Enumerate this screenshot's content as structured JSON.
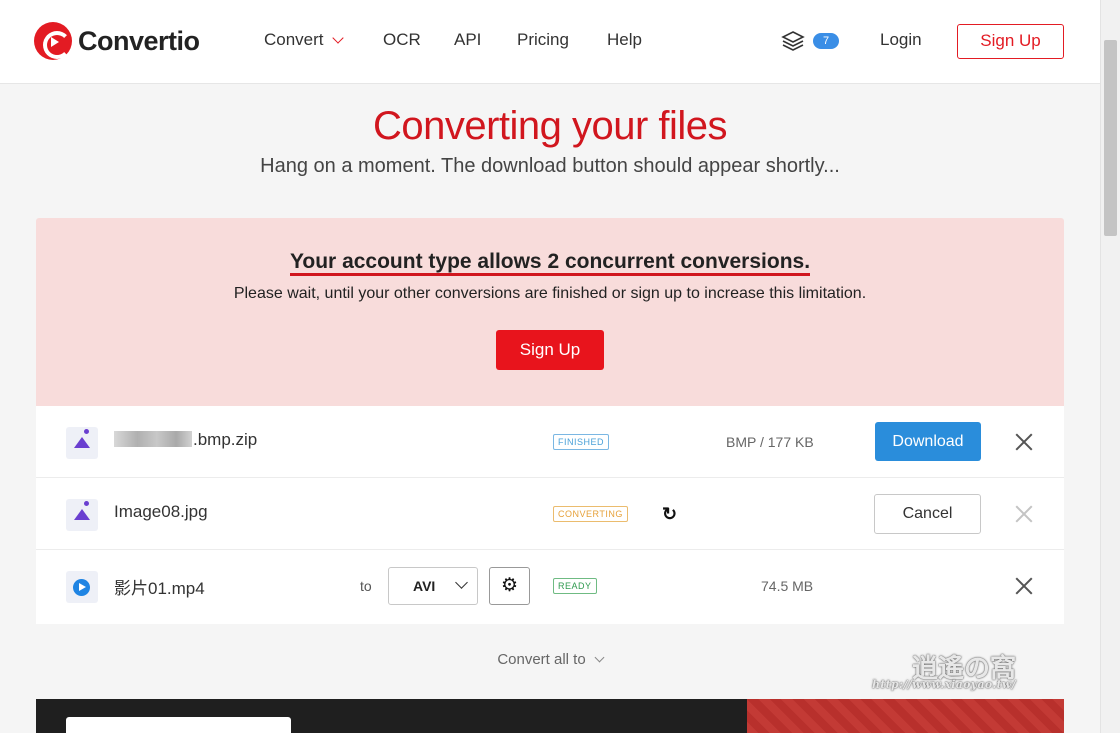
{
  "header": {
    "brand": "Convertio",
    "nav": {
      "convert": "Convert",
      "ocr": "OCR",
      "api": "API",
      "pricing": "Pricing",
      "help": "Help"
    },
    "files_badge": "7",
    "login": "Login",
    "signup": "Sign Up"
  },
  "page": {
    "title": "Converting your files",
    "subtitle": "Hang on a moment. The download button should appear shortly..."
  },
  "alert": {
    "headline": "Your account type allows 2 concurrent conversions.",
    "message": "Please wait, until your other conversions are finished or sign up to increase this limitation.",
    "button": "Sign Up"
  },
  "files": [
    {
      "name": ".bmp.zip",
      "status": "FINISHED",
      "meta": "BMP / 177 KB",
      "action": "Download",
      "icon": "image-icon"
    },
    {
      "name": "Image08.jpg",
      "status": "CONVERTING",
      "action": "Cancel",
      "icon": "image-icon",
      "spinner": "↻"
    },
    {
      "name": "影片01.mp4",
      "to_label": "to",
      "format": "AVI",
      "status": "READY",
      "meta": "74.5 MB",
      "icon": "video-icon",
      "settings_glyph": "⚙"
    }
  ],
  "convert_all": "Convert all to",
  "watermark": {
    "logo": "逍遙の窩",
    "url": "http://www.xiaoyao.tw/"
  },
  "colors": {
    "brand_red": "#e31b23",
    "title_red": "#d1161e",
    "alert_bg": "#f8dcdb",
    "download_blue": "#2a8ddb",
    "status_finished": "#4aa0d8",
    "status_converting": "#e6a13a",
    "status_ready": "#2f9a4f"
  }
}
